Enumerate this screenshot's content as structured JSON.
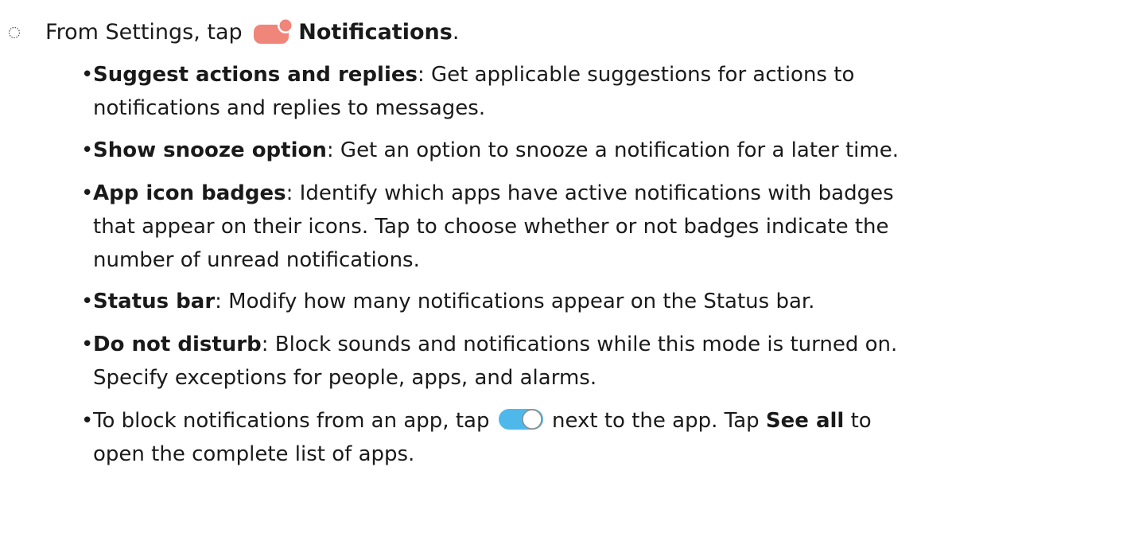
{
  "step": {
    "prefix": "From Settings, tap",
    "link": "Notifications",
    "suffix": "."
  },
  "bullet_symbol": "•",
  "items": [
    {
      "term": "Suggest actions and replies",
      "lines": [
        ": Get applicable suggestions for actions to",
        "notifications and replies to messages."
      ]
    },
    {
      "term": "Show snooze option",
      "lines": [
        ": Get an option to snooze a notification for a later time."
      ]
    },
    {
      "term": "App icon badges",
      "lines": [
        ": Identify which apps have active notifications with badges",
        "that appear on their icons. Tap to choose whether or not badges indicate the",
        "number of unread notifications."
      ]
    },
    {
      "term": "Status bar",
      "lines": [
        ": Modify how many notifications appear on the Status bar."
      ]
    },
    {
      "term": "Do not disturb",
      "lines": [
        ": Block sounds and notifications while this mode is turned on.",
        "Specify exceptions for people, apps, and alarms."
      ]
    },
    {
      "block": {
        "before": "To block notifications from an app, tap",
        "after": "next to the app. Tap",
        "see_all": "See all",
        "after2": "to",
        "line2": "open the complete list of apps."
      }
    }
  ],
  "colors": {
    "notification_icon": "#f0857a",
    "toggle_on": "#4fb8ea",
    "text": "#1a1a1a"
  },
  "icons": {
    "step_marker": "dotted-circle-icon",
    "notifications": "notifications-icon",
    "toggle": "toggle-switch-icon"
  }
}
